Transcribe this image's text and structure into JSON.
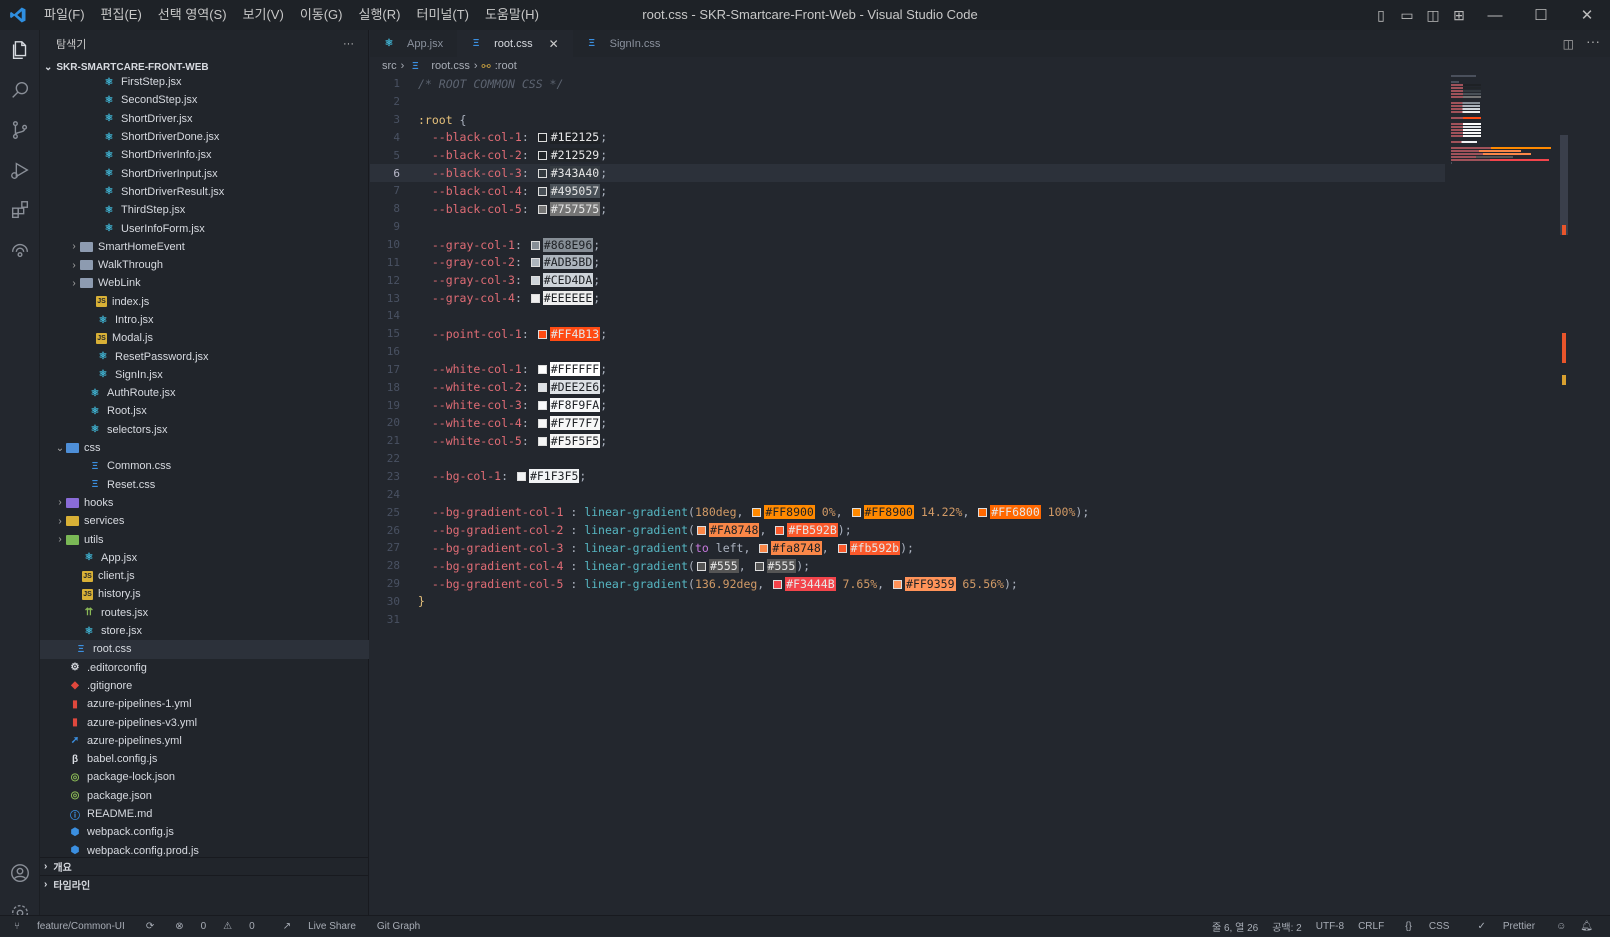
{
  "window": {
    "title": "root.css - SKR-Smartcare-Front-Web - Visual Studio Code"
  },
  "menu": [
    "파일(F)",
    "편집(E)",
    "선택 영역(S)",
    "보기(V)",
    "이동(G)",
    "실행(R)",
    "터미널(T)",
    "도움말(H)"
  ],
  "sidebar": {
    "title": "탐색기",
    "root": "SKR-SMARTCARE-FRONT-WEB",
    "items": [
      {
        "label": "FirstStep.jsx",
        "icon": "react",
        "indent": 62
      },
      {
        "label": "SecondStep.jsx",
        "icon": "react",
        "indent": 62
      },
      {
        "label": "ShortDriver.jsx",
        "icon": "react",
        "indent": 62
      },
      {
        "label": "ShortDriverDone.jsx",
        "icon": "react",
        "indent": 62
      },
      {
        "label": "ShortDriverInfo.jsx",
        "icon": "react",
        "indent": 62
      },
      {
        "label": "ShortDriverInput.jsx",
        "icon": "react",
        "indent": 62
      },
      {
        "label": "ShortDriverResult.jsx",
        "icon": "react",
        "indent": 62
      },
      {
        "label": "ThirdStep.jsx",
        "icon": "react",
        "indent": 62
      },
      {
        "label": "UserInfoForm.jsx",
        "icon": "react",
        "indent": 62
      },
      {
        "label": "SmartHomeEvent",
        "icon": "folder",
        "indent": 42,
        "chev": "›"
      },
      {
        "label": "WalkThrough",
        "icon": "folder",
        "indent": 42,
        "chev": "›"
      },
      {
        "label": "WebLink",
        "icon": "folder",
        "indent": 42,
        "chev": "›"
      },
      {
        "label": "index.js",
        "icon": "js",
        "indent": 56
      },
      {
        "label": "Intro.jsx",
        "icon": "react",
        "indent": 56
      },
      {
        "label": "Modal.js",
        "icon": "js",
        "indent": 56
      },
      {
        "label": "ResetPassword.jsx",
        "icon": "react",
        "indent": 56
      },
      {
        "label": "SignIn.jsx",
        "icon": "react",
        "indent": 56
      },
      {
        "label": "AuthRoute.jsx",
        "icon": "react",
        "indent": 48
      },
      {
        "label": "Root.jsx",
        "icon": "react",
        "indent": 48
      },
      {
        "label": "selectors.jsx",
        "icon": "react",
        "indent": 48
      },
      {
        "label": "css",
        "icon": "folder-blue",
        "indent": 28,
        "chev": "⌄"
      },
      {
        "label": "Common.css",
        "icon": "css",
        "indent": 48
      },
      {
        "label": "Reset.css",
        "icon": "css",
        "indent": 48
      },
      {
        "label": "hooks",
        "icon": "folder-purple",
        "indent": 28,
        "chev": "›"
      },
      {
        "label": "services",
        "icon": "folder-yellow",
        "indent": 28,
        "chev": "›"
      },
      {
        "label": "utils",
        "icon": "folder-green",
        "indent": 28,
        "chev": "›"
      },
      {
        "label": "App.jsx",
        "icon": "react",
        "indent": 42
      },
      {
        "label": "client.js",
        "icon": "js",
        "indent": 42
      },
      {
        "label": "history.js",
        "icon": "js",
        "indent": 42
      },
      {
        "label": "routes.jsx",
        "icon": "route",
        "indent": 42
      },
      {
        "label": "store.jsx",
        "icon": "react",
        "indent": 42
      },
      {
        "label": "root.css",
        "icon": "css",
        "indent": 34,
        "selected": true
      },
      {
        "label": ".editorconfig",
        "icon": "gear",
        "indent": 28
      },
      {
        "label": ".gitignore",
        "icon": "git",
        "indent": 28
      },
      {
        "label": "azure-pipelines-1.yml",
        "icon": "yml",
        "indent": 28
      },
      {
        "label": "azure-pipelines-v3.yml",
        "icon": "yml",
        "indent": 28
      },
      {
        "label": "azure-pipelines.yml",
        "icon": "rocket",
        "indent": 28
      },
      {
        "label": "babel.config.js",
        "icon": "babel",
        "indent": 28
      },
      {
        "label": "package-lock.json",
        "icon": "json",
        "indent": 28
      },
      {
        "label": "package.json",
        "icon": "json",
        "indent": 28
      },
      {
        "label": "README.md",
        "icon": "info",
        "indent": 28
      },
      {
        "label": "webpack.config.js",
        "icon": "webpack",
        "indent": 28
      },
      {
        "label": "webpack.config.prod.js",
        "icon": "webpack",
        "indent": 28
      }
    ],
    "outline": "개요",
    "timeline": "타임라인"
  },
  "tabs": [
    {
      "label": "App.jsx",
      "icon": "react"
    },
    {
      "label": "root.css",
      "icon": "css",
      "active": true
    },
    {
      "label": "SignIn.css",
      "icon": "css"
    }
  ],
  "breadcrumb": {
    "folder": "src",
    "file": "root.css",
    "symbol": ":root"
  },
  "editor": {
    "cursor_line": 6,
    "lines": [
      {
        "n": "1",
        "t": [
          [
            "c-com",
            "/* ROOT COMMON CSS */"
          ]
        ]
      },
      {
        "n": "2",
        "t": []
      },
      {
        "n": "3",
        "t": [
          [
            "c-sel",
            ":root"
          ],
          [
            "c-pun",
            " {"
          ]
        ]
      },
      {
        "n": "4",
        "t": [
          [
            "c-var",
            "  --black-col-1"
          ],
          [
            "c-pun",
            ": "
          ],
          [
            "sw",
            "#1E2125"
          ],
          [
            "c-pun",
            ";"
          ]
        ]
      },
      {
        "n": "5",
        "t": [
          [
            "c-var",
            "  --black-col-2"
          ],
          [
            "c-pun",
            ": "
          ],
          [
            "sw",
            "#212529"
          ],
          [
            "c-pun",
            ";"
          ]
        ]
      },
      {
        "n": "6",
        "t": [
          [
            "c-var",
            "  --black-col-3"
          ],
          [
            "c-pun",
            ": "
          ],
          [
            "sw",
            "#343A40"
          ],
          [
            "c-pun",
            ";"
          ]
        ]
      },
      {
        "n": "7",
        "t": [
          [
            "c-var",
            "  --black-col-4"
          ],
          [
            "c-pun",
            ": "
          ],
          [
            "sw",
            "#495057"
          ],
          [
            "c-pun",
            ";"
          ]
        ]
      },
      {
        "n": "8",
        "t": [
          [
            "c-var",
            "  --black-col-5"
          ],
          [
            "c-pun",
            ": "
          ],
          [
            "sw",
            "#757575"
          ],
          [
            "c-pun",
            ";"
          ]
        ]
      },
      {
        "n": "9",
        "t": []
      },
      {
        "n": "10",
        "t": [
          [
            "c-var",
            "  --gray-col-1"
          ],
          [
            "c-pun",
            ": "
          ],
          [
            "sw",
            "#868E96"
          ],
          [
            "c-pun",
            ";"
          ]
        ]
      },
      {
        "n": "11",
        "t": [
          [
            "c-var",
            "  --gray-col-2"
          ],
          [
            "c-pun",
            ": "
          ],
          [
            "sw",
            "#ADB5BD"
          ],
          [
            "c-pun",
            ";"
          ]
        ]
      },
      {
        "n": "12",
        "t": [
          [
            "c-var",
            "  --gray-col-3"
          ],
          [
            "c-pun",
            ": "
          ],
          [
            "sw",
            "#CED4DA"
          ],
          [
            "c-pun",
            ";"
          ]
        ]
      },
      {
        "n": "13",
        "t": [
          [
            "c-var",
            "  --gray-col-4"
          ],
          [
            "c-pun",
            ": "
          ],
          [
            "sw",
            "#EEEEEE"
          ],
          [
            "c-pun",
            ";"
          ]
        ]
      },
      {
        "n": "14",
        "t": []
      },
      {
        "n": "15",
        "t": [
          [
            "c-var",
            "  --point-col-1"
          ],
          [
            "c-pun",
            ": "
          ],
          [
            "sw",
            "#FF4B13"
          ],
          [
            "c-pun",
            ";"
          ]
        ]
      },
      {
        "n": "16",
        "t": []
      },
      {
        "n": "17",
        "t": [
          [
            "c-var",
            "  --white-col-1"
          ],
          [
            "c-pun",
            ": "
          ],
          [
            "sw",
            "#FFFFFF"
          ],
          [
            "c-pun",
            ";"
          ]
        ]
      },
      {
        "n": "18",
        "t": [
          [
            "c-var",
            "  --white-col-2"
          ],
          [
            "c-pun",
            ": "
          ],
          [
            "sw",
            "#DEE2E6"
          ],
          [
            "c-pun",
            ";"
          ]
        ]
      },
      {
        "n": "19",
        "t": [
          [
            "c-var",
            "  --white-col-3"
          ],
          [
            "c-pun",
            ": "
          ],
          [
            "sw",
            "#F8F9FA"
          ],
          [
            "c-pun",
            ";"
          ]
        ]
      },
      {
        "n": "20",
        "t": [
          [
            "c-var",
            "  --white-col-4"
          ],
          [
            "c-pun",
            ": "
          ],
          [
            "sw",
            "#F7F7F7"
          ],
          [
            "c-pun",
            ";"
          ]
        ]
      },
      {
        "n": "21",
        "t": [
          [
            "c-var",
            "  --white-col-5"
          ],
          [
            "c-pun",
            ": "
          ],
          [
            "sw",
            "#F5F5F5"
          ],
          [
            "c-pun",
            ";"
          ]
        ]
      },
      {
        "n": "22",
        "t": []
      },
      {
        "n": "23",
        "t": [
          [
            "c-var",
            "  --bg-col-1"
          ],
          [
            "c-pun",
            ": "
          ],
          [
            "sw",
            "#F1F3F5"
          ],
          [
            "c-pun",
            ";"
          ]
        ]
      },
      {
        "n": "24",
        "t": []
      },
      {
        "n": "25",
        "t": [
          [
            "c-var",
            "  --bg-gradient-col-1"
          ],
          [
            "c-pun",
            " : "
          ],
          [
            "c-fn",
            "linear-gradient"
          ],
          [
            "c-pun",
            "("
          ],
          [
            "c-num",
            "180deg"
          ],
          [
            "c-pun",
            ", "
          ],
          [
            "sw",
            "#FF8900"
          ],
          [
            "c-num",
            " 0%"
          ],
          [
            "c-pun",
            ", "
          ],
          [
            "sw",
            "#FF8900"
          ],
          [
            "c-num",
            " 14.22%"
          ],
          [
            "c-pun",
            ", "
          ],
          [
            "sw",
            "#FF6800"
          ],
          [
            "c-num",
            " 100%"
          ],
          [
            "c-pun",
            ");"
          ]
        ]
      },
      {
        "n": "26",
        "t": [
          [
            "c-var",
            "  --bg-gradient-col-2"
          ],
          [
            "c-pun",
            " : "
          ],
          [
            "c-fn",
            "linear-gradient"
          ],
          [
            "c-pun",
            "("
          ],
          [
            "sw",
            "#FA8748"
          ],
          [
            "c-pun",
            ", "
          ],
          [
            "sw",
            "#FB592B"
          ],
          [
            "c-pun",
            ");"
          ]
        ]
      },
      {
        "n": "27",
        "t": [
          [
            "c-var",
            "  --bg-gradient-col-3"
          ],
          [
            "c-pun",
            " : "
          ],
          [
            "c-fn",
            "linear-gradient"
          ],
          [
            "c-pun",
            "("
          ],
          [
            "c-kw",
            "to"
          ],
          [
            "c-pun",
            " left, "
          ],
          [
            "sw",
            "#fa8748"
          ],
          [
            "c-pun",
            ", "
          ],
          [
            "sw",
            "#fb592b"
          ],
          [
            "c-pun",
            ");"
          ]
        ]
      },
      {
        "n": "28",
        "t": [
          [
            "c-var",
            "  --bg-gradient-col-4"
          ],
          [
            "c-pun",
            " : "
          ],
          [
            "c-fn",
            "linear-gradient"
          ],
          [
            "c-pun",
            "("
          ],
          [
            "sw",
            "#555"
          ],
          [
            "c-pun",
            ", "
          ],
          [
            "sw",
            "#555"
          ],
          [
            "c-pun",
            ");"
          ]
        ]
      },
      {
        "n": "29",
        "t": [
          [
            "c-var",
            "  --bg-gradient-col-5"
          ],
          [
            "c-pun",
            " : "
          ],
          [
            "c-fn",
            "linear-gradient"
          ],
          [
            "c-pun",
            "("
          ],
          [
            "c-num",
            "136.92deg"
          ],
          [
            "c-pun",
            ", "
          ],
          [
            "sw",
            "#F3444B"
          ],
          [
            "c-num",
            " 7.65%"
          ],
          [
            "c-pun",
            ", "
          ],
          [
            "sw",
            "#FF9359"
          ],
          [
            "c-num",
            " 65.56%"
          ],
          [
            "c-pun",
            ");"
          ]
        ]
      },
      {
        "n": "30",
        "t": [
          [
            "c-sel",
            "}"
          ]
        ]
      },
      {
        "n": "31",
        "t": []
      }
    ]
  },
  "status": {
    "branch": "feature/Common-UI",
    "errors": "0",
    "warnings": "0",
    "liveshare": "Live Share",
    "gitgraph": "Git Graph",
    "position": "줄 6, 열 26",
    "spaces": "공백: 2",
    "encoding": "UTF-8",
    "eol": "CRLF",
    "language": "CSS",
    "formatter": "Prettier"
  },
  "colors": {
    "accent": "#3b8fe0",
    "bg": "#23272e",
    "sidebar": "#21252b"
  }
}
